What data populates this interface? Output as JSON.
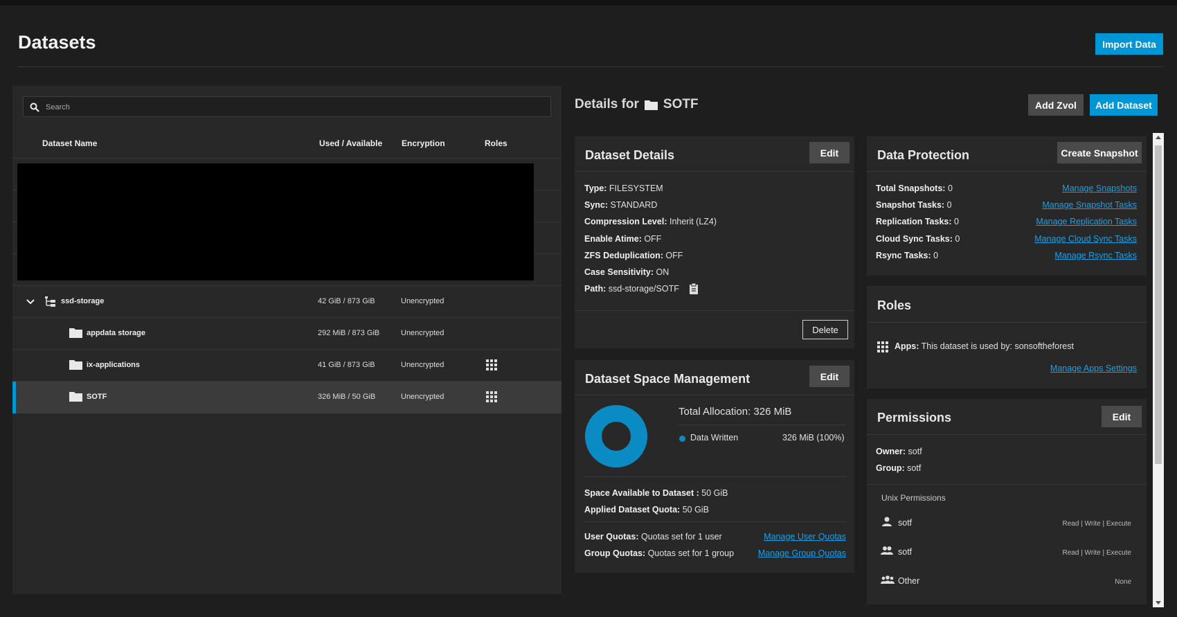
{
  "page": {
    "title": "Datasets",
    "import_button": "Import Data"
  },
  "search": {
    "placeholder": "Search"
  },
  "table": {
    "headers": {
      "name": "Dataset Name",
      "used": "Used / Available",
      "encryption": "Encryption",
      "roles": "Roles"
    },
    "rows": [
      {
        "name": "ssd-storage",
        "used": "42 GiB / 873 GiB",
        "encryption": "Unencrypted"
      },
      {
        "name": "appdata storage",
        "used": "292 MiB / 873 GiB",
        "encryption": "Unencrypted"
      },
      {
        "name": "ix-applications",
        "used": "41 GiB / 873 GiB",
        "encryption": "Unencrypted"
      },
      {
        "name": "SOTF",
        "used": "326 MiB / 50 GiB",
        "encryption": "Unencrypted"
      }
    ]
  },
  "details": {
    "prefix": "Details for",
    "dataset": "SOTF",
    "add_zvol": "Add Zvol",
    "add_dataset": "Add Dataset"
  },
  "dataset_details": {
    "title": "Dataset Details",
    "edit": "Edit",
    "delete": "Delete",
    "items": [
      {
        "k": "Type:",
        "v": "FILESYSTEM"
      },
      {
        "k": "Sync:",
        "v": "STANDARD"
      },
      {
        "k": "Compression Level:",
        "v": "Inherit (LZ4)"
      },
      {
        "k": "Enable Atime:",
        "v": "OFF"
      },
      {
        "k": "ZFS Deduplication:",
        "v": "OFF"
      },
      {
        "k": "Case Sensitivity:",
        "v": "ON"
      },
      {
        "k": "Path:",
        "v": "ssd-storage/SOTF"
      }
    ]
  },
  "space": {
    "title": "Dataset Space Management",
    "edit": "Edit",
    "total_label": "Total Allocation:",
    "total_value": "326 MiB",
    "legend_label": "Data Written",
    "legend_value": "326 MiB (100%)",
    "data_written_fraction": 1.0,
    "color": "#0a8bc4",
    "available_k": "Space Available to Dataset :",
    "available_v": "50 GiB",
    "quota_k": "Applied Dataset Quota:",
    "quota_v": "50 GiB",
    "user_quota_k": "User Quotas:",
    "user_quota_v": "Quotas set for 1 user",
    "user_quota_link": "Manage User Quotas",
    "group_quota_k": "Group Quotas:",
    "group_quota_v": "Quotas set for 1 group",
    "group_quota_link": "Manage Group Quotas"
  },
  "protection": {
    "title": "Data Protection",
    "create": "Create Snapshot",
    "items": [
      {
        "k": "Total Snapshots:",
        "v": "0",
        "link": "Manage Snapshots"
      },
      {
        "k": "Snapshot Tasks:",
        "v": "0",
        "link": "Manage Snapshot Tasks"
      },
      {
        "k": "Replication Tasks:",
        "v": "0",
        "link": "Manage Replication Tasks"
      },
      {
        "k": "Cloud Sync Tasks:",
        "v": "0",
        "link": "Manage Cloud Sync Tasks"
      },
      {
        "k": "Rsync Tasks:",
        "v": "0",
        "link": "Manage Rsync Tasks"
      }
    ]
  },
  "roles": {
    "title": "Roles",
    "apps_k": "Apps:",
    "apps_v": "This dataset is used by: sonsoftheforest",
    "link": "Manage Apps Settings"
  },
  "permissions": {
    "title": "Permissions",
    "edit": "Edit",
    "owner_k": "Owner:",
    "owner_v": "sotf",
    "group_k": "Group:",
    "group_v": "sotf",
    "unix_label": "Unix Permissions",
    "entries": [
      {
        "name": "sotf",
        "perm": "Read | Write | Execute"
      },
      {
        "name": "sotf",
        "perm": "Read | Write | Execute"
      },
      {
        "name": "Other",
        "perm": "None"
      }
    ]
  }
}
